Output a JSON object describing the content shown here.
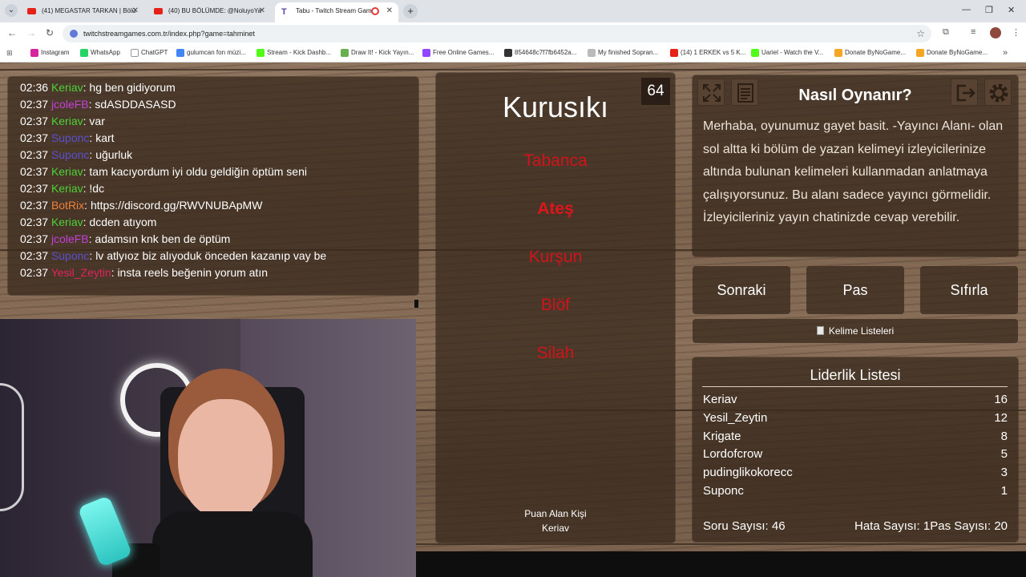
{
  "browser": {
    "tabs": [
      {
        "title": "(41) MEGASTAR TARKAN | Bölü",
        "icon": "youtube-icon"
      },
      {
        "title": "(40) BU BÖLÜMDE: @NoluyoYa",
        "icon": "youtube-icon"
      },
      {
        "title": "Tabu - Twitch Stream Game",
        "icon": "twitch-icon",
        "recording": true
      }
    ],
    "url": "twitchstreamgames.com.tr/index.php?game=tahminet",
    "bookmarks": [
      {
        "label": "Instagram",
        "color": "#d6249f"
      },
      {
        "label": "WhatsApp",
        "color": "#25d366"
      },
      {
        "label": "ChatGPT",
        "color": "#ffffff"
      },
      {
        "label": "gulumcan fon müzi...",
        "color": "#4285f4"
      },
      {
        "label": "Stream - Kick Dashb...",
        "color": "#53fc18"
      },
      {
        "label": "Draw It! - Kick Yayın...",
        "color": "#6ab04c"
      },
      {
        "label": "Free Online Games...",
        "color": "#9146ff"
      },
      {
        "label": "854648c7f7fb6452a...",
        "color": "#333333"
      },
      {
        "label": "My finished Sopran...",
        "color": "#bbbbbb"
      },
      {
        "label": "(14) 1 ERKEK vs 5 K...",
        "color": "#e62117"
      },
      {
        "label": "Uariel - Watch the V...",
        "color": "#53fc18"
      },
      {
        "label": "Donate ByNoGame...",
        "color": "#f5a623"
      },
      {
        "label": "Donate ByNoGame...",
        "color": "#f5a623"
      }
    ]
  },
  "chat": [
    {
      "time": "02:36",
      "user": "Keriav",
      "color": "#4cd137",
      "msg": ": hg ben gidiyorum"
    },
    {
      "time": "02:37",
      "user": "jcoleFB",
      "color": "#c440d8",
      "msg": ": sdASDDASASD"
    },
    {
      "time": "02:37",
      "user": "Keriav",
      "color": "#4cd137",
      "msg": ": var"
    },
    {
      "time": "02:37",
      "user": "Suponc",
      "color": "#5a4fcf",
      "msg": ": kart"
    },
    {
      "time": "02:37",
      "user": "Suponc",
      "color": "#5a4fcf",
      "msg": ": uğurluk"
    },
    {
      "time": "02:37",
      "user": "Keriav",
      "color": "#4cd137",
      "msg": ": tam kacıyordum iyi oldu geldiğin öptüm seni"
    },
    {
      "time": "02:37",
      "user": "Keriav",
      "color": "#4cd137",
      "msg": ": !dc"
    },
    {
      "time": "02:37",
      "user": "BotRix",
      "color": "#f0803c",
      "msg": ": https://discord.gg/RWVNUBApMW"
    },
    {
      "time": "02:37",
      "user": "Keriav",
      "color": "#4cd137",
      "msg": ": dcden atıyom"
    },
    {
      "time": "02:37",
      "user": "jcoleFB",
      "color": "#c440d8",
      "msg": ": adamsın knk ben de öptüm"
    },
    {
      "time": "02:37",
      "user": "Suponc",
      "color": "#5a4fcf",
      "msg": ": lv atlyıoz biz alıyoduk önceden kazanıp vay be"
    },
    {
      "time": "02:37",
      "user": "Yesil_Zeytin",
      "color": "#e0245e",
      "msg": ": insta reels beğenin yorum atın"
    }
  ],
  "game": {
    "timer": "64",
    "word": "Kurusıkı",
    "taboo": [
      {
        "text": "Tabanca",
        "highlight": false
      },
      {
        "text": "Ateş",
        "highlight": true
      },
      {
        "text": "Kurşun",
        "highlight": false
      },
      {
        "text": "Blöf",
        "highlight": false
      },
      {
        "text": "Silah",
        "highlight": false
      }
    ],
    "scorer_label": "Puan Alan Kişi",
    "scorer_name": "Keriav"
  },
  "how_to": {
    "title": "Nasıl Oynanır?",
    "text": "Merhaba, oyunumuz gayet basit. -Yayıncı Alanı- olan sol altta ki bölüm de yazan kelimeyi izleyicilerinize altında bulunan kelimeleri kullanmadan anlatmaya çalışıyorsunuz. Bu alanı sadece yayıncı görmelidir. İzleyicileriniz yayın chatinizde cevap verebilir."
  },
  "actions": {
    "next": "Sonraki",
    "pass": "Pas",
    "reset": "Sıfırla",
    "word_lists": "Kelime Listeleri"
  },
  "leaderboard": {
    "title": "Liderlik Listesi",
    "rows": [
      {
        "name": "Keriav",
        "score": "16"
      },
      {
        "name": "Yesil_Zeytin",
        "score": "12"
      },
      {
        "name": "Krigate",
        "score": "8"
      },
      {
        "name": "Lordofcrow",
        "score": "5"
      },
      {
        "name": "pudinglikokorecc",
        "score": "3"
      },
      {
        "name": "Suponc",
        "score": "1"
      }
    ],
    "questions": "Soru Sayısı: 46",
    "errors": "Hata Sayısı: 1",
    "passes": "Pas Sayısı: 20"
  }
}
